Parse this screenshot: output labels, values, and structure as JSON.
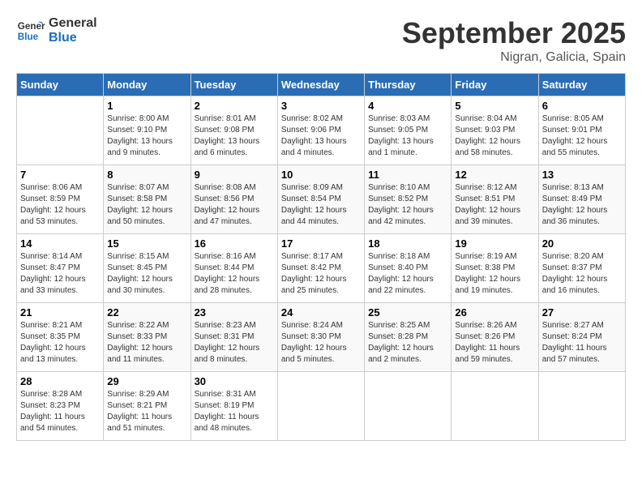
{
  "header": {
    "logo_line1": "General",
    "logo_line2": "Blue",
    "month": "September 2025",
    "location": "Nigran, Galicia, Spain"
  },
  "weekdays": [
    "Sunday",
    "Monday",
    "Tuesday",
    "Wednesday",
    "Thursday",
    "Friday",
    "Saturday"
  ],
  "weeks": [
    [
      {
        "day": "",
        "sunrise": "",
        "sunset": "",
        "daylight": ""
      },
      {
        "day": "1",
        "sunrise": "Sunrise: 8:00 AM",
        "sunset": "Sunset: 9:10 PM",
        "daylight": "Daylight: 13 hours and 9 minutes."
      },
      {
        "day": "2",
        "sunrise": "Sunrise: 8:01 AM",
        "sunset": "Sunset: 9:08 PM",
        "daylight": "Daylight: 13 hours and 6 minutes."
      },
      {
        "day": "3",
        "sunrise": "Sunrise: 8:02 AM",
        "sunset": "Sunset: 9:06 PM",
        "daylight": "Daylight: 13 hours and 4 minutes."
      },
      {
        "day": "4",
        "sunrise": "Sunrise: 8:03 AM",
        "sunset": "Sunset: 9:05 PM",
        "daylight": "Daylight: 13 hours and 1 minute."
      },
      {
        "day": "5",
        "sunrise": "Sunrise: 8:04 AM",
        "sunset": "Sunset: 9:03 PM",
        "daylight": "Daylight: 12 hours and 58 minutes."
      },
      {
        "day": "6",
        "sunrise": "Sunrise: 8:05 AM",
        "sunset": "Sunset: 9:01 PM",
        "daylight": "Daylight: 12 hours and 55 minutes."
      }
    ],
    [
      {
        "day": "7",
        "sunrise": "Sunrise: 8:06 AM",
        "sunset": "Sunset: 8:59 PM",
        "daylight": "Daylight: 12 hours and 53 minutes."
      },
      {
        "day": "8",
        "sunrise": "Sunrise: 8:07 AM",
        "sunset": "Sunset: 8:58 PM",
        "daylight": "Daylight: 12 hours and 50 minutes."
      },
      {
        "day": "9",
        "sunrise": "Sunrise: 8:08 AM",
        "sunset": "Sunset: 8:56 PM",
        "daylight": "Daylight: 12 hours and 47 minutes."
      },
      {
        "day": "10",
        "sunrise": "Sunrise: 8:09 AM",
        "sunset": "Sunset: 8:54 PM",
        "daylight": "Daylight: 12 hours and 44 minutes."
      },
      {
        "day": "11",
        "sunrise": "Sunrise: 8:10 AM",
        "sunset": "Sunset: 8:52 PM",
        "daylight": "Daylight: 12 hours and 42 minutes."
      },
      {
        "day": "12",
        "sunrise": "Sunrise: 8:12 AM",
        "sunset": "Sunset: 8:51 PM",
        "daylight": "Daylight: 12 hours and 39 minutes."
      },
      {
        "day": "13",
        "sunrise": "Sunrise: 8:13 AM",
        "sunset": "Sunset: 8:49 PM",
        "daylight": "Daylight: 12 hours and 36 minutes."
      }
    ],
    [
      {
        "day": "14",
        "sunrise": "Sunrise: 8:14 AM",
        "sunset": "Sunset: 8:47 PM",
        "daylight": "Daylight: 12 hours and 33 minutes."
      },
      {
        "day": "15",
        "sunrise": "Sunrise: 8:15 AM",
        "sunset": "Sunset: 8:45 PM",
        "daylight": "Daylight: 12 hours and 30 minutes."
      },
      {
        "day": "16",
        "sunrise": "Sunrise: 8:16 AM",
        "sunset": "Sunset: 8:44 PM",
        "daylight": "Daylight: 12 hours and 28 minutes."
      },
      {
        "day": "17",
        "sunrise": "Sunrise: 8:17 AM",
        "sunset": "Sunset: 8:42 PM",
        "daylight": "Daylight: 12 hours and 25 minutes."
      },
      {
        "day": "18",
        "sunrise": "Sunrise: 8:18 AM",
        "sunset": "Sunset: 8:40 PM",
        "daylight": "Daylight: 12 hours and 22 minutes."
      },
      {
        "day": "19",
        "sunrise": "Sunrise: 8:19 AM",
        "sunset": "Sunset: 8:38 PM",
        "daylight": "Daylight: 12 hours and 19 minutes."
      },
      {
        "day": "20",
        "sunrise": "Sunrise: 8:20 AM",
        "sunset": "Sunset: 8:37 PM",
        "daylight": "Daylight: 12 hours and 16 minutes."
      }
    ],
    [
      {
        "day": "21",
        "sunrise": "Sunrise: 8:21 AM",
        "sunset": "Sunset: 8:35 PM",
        "daylight": "Daylight: 12 hours and 13 minutes."
      },
      {
        "day": "22",
        "sunrise": "Sunrise: 8:22 AM",
        "sunset": "Sunset: 8:33 PM",
        "daylight": "Daylight: 12 hours and 11 minutes."
      },
      {
        "day": "23",
        "sunrise": "Sunrise: 8:23 AM",
        "sunset": "Sunset: 8:31 PM",
        "daylight": "Daylight: 12 hours and 8 minutes."
      },
      {
        "day": "24",
        "sunrise": "Sunrise: 8:24 AM",
        "sunset": "Sunset: 8:30 PM",
        "daylight": "Daylight: 12 hours and 5 minutes."
      },
      {
        "day": "25",
        "sunrise": "Sunrise: 8:25 AM",
        "sunset": "Sunset: 8:28 PM",
        "daylight": "Daylight: 12 hours and 2 minutes."
      },
      {
        "day": "26",
        "sunrise": "Sunrise: 8:26 AM",
        "sunset": "Sunset: 8:26 PM",
        "daylight": "Daylight: 11 hours and 59 minutes."
      },
      {
        "day": "27",
        "sunrise": "Sunrise: 8:27 AM",
        "sunset": "Sunset: 8:24 PM",
        "daylight": "Daylight: 11 hours and 57 minutes."
      }
    ],
    [
      {
        "day": "28",
        "sunrise": "Sunrise: 8:28 AM",
        "sunset": "Sunset: 8:23 PM",
        "daylight": "Daylight: 11 hours and 54 minutes."
      },
      {
        "day": "29",
        "sunrise": "Sunrise: 8:29 AM",
        "sunset": "Sunset: 8:21 PM",
        "daylight": "Daylight: 11 hours and 51 minutes."
      },
      {
        "day": "30",
        "sunrise": "Sunrise: 8:31 AM",
        "sunset": "Sunset: 8:19 PM",
        "daylight": "Daylight: 11 hours and 48 minutes."
      },
      {
        "day": "",
        "sunrise": "",
        "sunset": "",
        "daylight": ""
      },
      {
        "day": "",
        "sunrise": "",
        "sunset": "",
        "daylight": ""
      },
      {
        "day": "",
        "sunrise": "",
        "sunset": "",
        "daylight": ""
      },
      {
        "day": "",
        "sunrise": "",
        "sunset": "",
        "daylight": ""
      }
    ]
  ]
}
